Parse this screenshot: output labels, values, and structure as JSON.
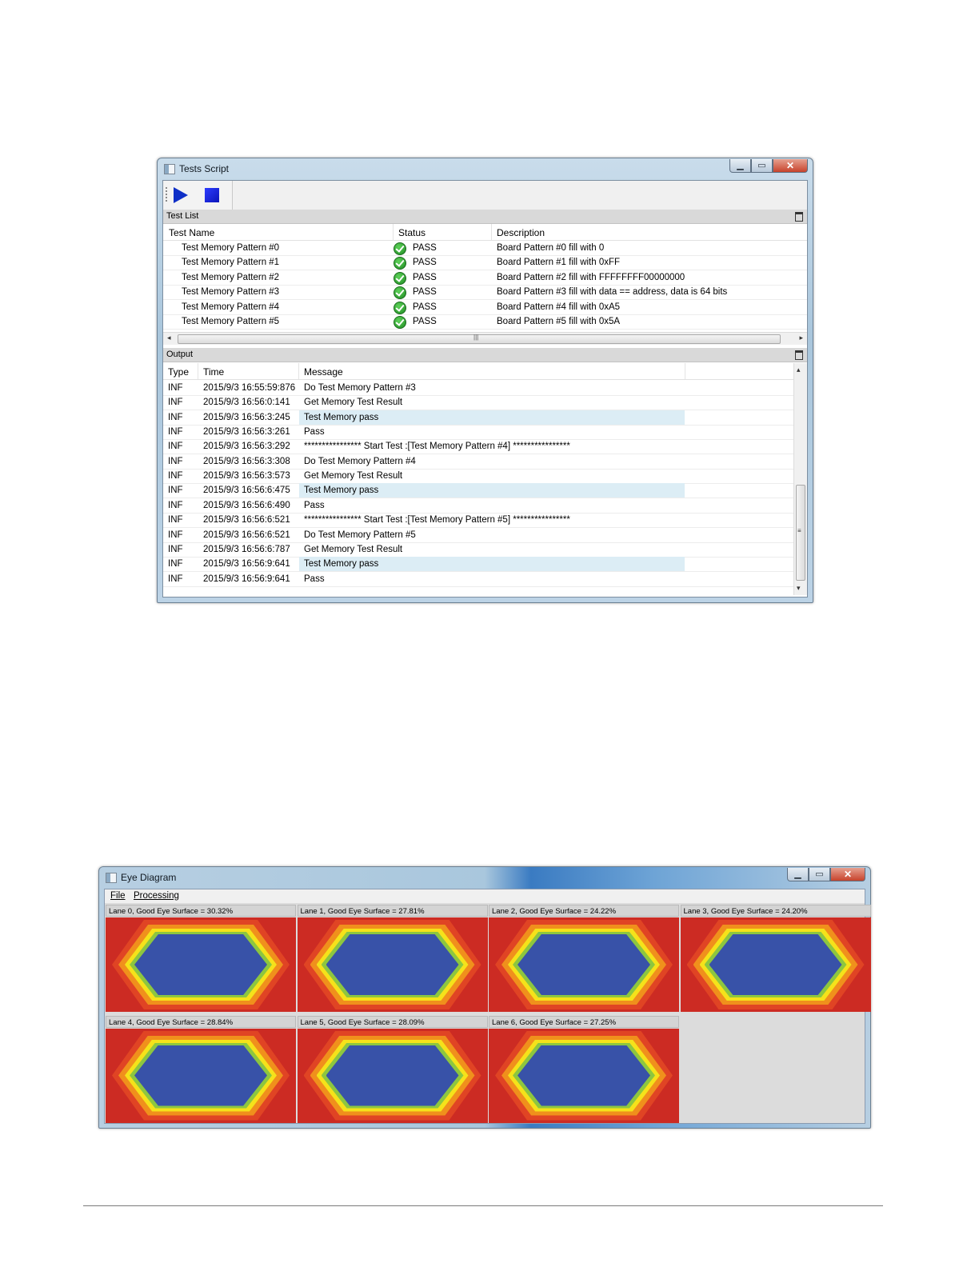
{
  "tests_window": {
    "title": "Tests Script",
    "toolbar": {
      "run_icon": "play-icon",
      "stop_icon": "stop-icon"
    },
    "test_list": {
      "header": "Test List",
      "columns": [
        "Test Name",
        "Status",
        "Description"
      ],
      "rows": [
        {
          "name": "Test Memory Pattern #0",
          "status": "PASS",
          "description": "Board Pattern #0 fill with 0"
        },
        {
          "name": "Test Memory Pattern #1",
          "status": "PASS",
          "description": "Board Pattern #1 fill with 0xFF"
        },
        {
          "name": "Test Memory Pattern #2",
          "status": "PASS",
          "description": "Board Pattern #2 fill with FFFFFFFF00000000"
        },
        {
          "name": "Test Memory Pattern #3",
          "status": "PASS",
          "description": "Board Pattern #3 fill with data == address, data is 64 bits"
        },
        {
          "name": "Test Memory Pattern #4",
          "status": "PASS",
          "description": "Board Pattern #4 fill with 0xA5"
        },
        {
          "name": "Test Memory Pattern #5",
          "status": "PASS",
          "description": "Board Pattern #5 fill with 0x5A"
        }
      ]
    },
    "output": {
      "header": "Output",
      "columns": [
        "Type",
        "Time",
        "Message"
      ],
      "rows": [
        {
          "type": "INF",
          "time": "2015/9/3 16:55:59:876",
          "message": "Do Test Memory Pattern #3"
        },
        {
          "type": "INF",
          "time": "2015/9/3 16:56:0:141",
          "message": "Get Memory Test Result"
        },
        {
          "type": "INF",
          "time": "2015/9/3 16:56:3:245",
          "message": "Test Memory pass"
        },
        {
          "type": "INF",
          "time": "2015/9/3 16:56:3:261",
          "message": "Pass"
        },
        {
          "type": "INF",
          "time": "2015/9/3 16:56:3:292",
          "message": "**************** Start Test :[Test Memory Pattern #4] ****************"
        },
        {
          "type": "INF",
          "time": "2015/9/3 16:56:3:308",
          "message": "Do Test Memory Pattern #4"
        },
        {
          "type": "INF",
          "time": "2015/9/3 16:56:3:573",
          "message": "Get Memory Test Result"
        },
        {
          "type": "INF",
          "time": "2015/9/3 16:56:6:475",
          "message": "Test Memory pass"
        },
        {
          "type": "INF",
          "time": "2015/9/3 16:56:6:490",
          "message": "Pass"
        },
        {
          "type": "INF",
          "time": "2015/9/3 16:56:6:521",
          "message": "**************** Start Test :[Test Memory Pattern #5] ****************"
        },
        {
          "type": "INF",
          "time": "2015/9/3 16:56:6:521",
          "message": "Do Test Memory Pattern #5"
        },
        {
          "type": "INF",
          "time": "2015/9/3 16:56:6:787",
          "message": "Get Memory Test Result"
        },
        {
          "type": "INF",
          "time": "2015/9/3 16:56:9:641",
          "message": "Test Memory pass"
        },
        {
          "type": "INF",
          "time": "2015/9/3 16:56:9:641",
          "message": "Pass"
        }
      ]
    }
  },
  "eye_window": {
    "title": "Eye Diagram",
    "menu": {
      "file": "File",
      "processing": "Processing"
    },
    "lanes": [
      {
        "label": "Lane 0, Good Eye Surface =  30.32%"
      },
      {
        "label": "Lane 1, Good Eye Surface =  27.81%"
      },
      {
        "label": "Lane 2, Good Eye Surface =  24.22%"
      },
      {
        "label": "Lane 3, Good Eye Surface =  24.20%"
      },
      {
        "label": "Lane 4, Good Eye Surface =  28.84%"
      },
      {
        "label": "Lane 5, Good Eye Surface =  28.09%"
      },
      {
        "label": "Lane 6, Good Eye Surface =  27.25%"
      }
    ]
  },
  "colors": {
    "eye_background": "#cc2b23",
    "eye_center": "#3852a8",
    "highlight_row": "#dcedf5"
  }
}
